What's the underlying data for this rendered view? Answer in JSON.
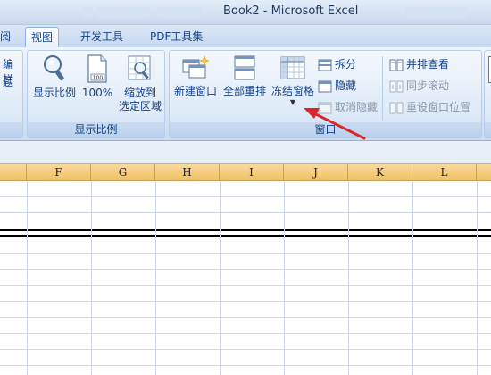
{
  "window": {
    "title": "Book2 - Microsoft Excel"
  },
  "tabs": [
    {
      "label": "阅"
    },
    {
      "label": "视图"
    },
    {
      "label": "开发工具"
    },
    {
      "label": "PDF工具集"
    }
  ],
  "ribbon": {
    "left_partial": [
      "编栏",
      "题"
    ],
    "zoom_group": {
      "label": "显示比例",
      "buttons": [
        {
          "label": "显示比例",
          "icon": "magnifier-icon"
        },
        {
          "label": "100%",
          "icon": "page-100-icon"
        },
        {
          "label_line1": "缩放到",
          "label_line2": "选定区域",
          "icon": "zoom-to-selection-icon"
        }
      ]
    },
    "window_group": {
      "label": "窗口",
      "big_buttons": [
        {
          "label": "新建窗口",
          "icon": "new-window-icon"
        },
        {
          "label": "全部重排",
          "icon": "arrange-all-icon"
        },
        {
          "label": "冻结窗格",
          "icon": "freeze-panes-icon"
        }
      ],
      "small_buttons_col1": [
        {
          "label": "拆分",
          "icon": "split-icon",
          "enabled": true
        },
        {
          "label": "隐藏",
          "icon": "hide-icon",
          "enabled": true
        },
        {
          "label": "取消隐藏",
          "icon": "unhide-icon",
          "enabled": false
        }
      ],
      "small_buttons_col2": [
        {
          "label": "并排查看",
          "icon": "side-by-side-icon",
          "enabled": true
        },
        {
          "label": "同步滚动",
          "icon": "sync-scroll-icon",
          "enabled": false
        },
        {
          "label": "重设窗口位置",
          "icon": "reset-window-icon",
          "enabled": false
        }
      ]
    }
  },
  "columns": [
    "F",
    "G",
    "H",
    "I",
    "J",
    "K",
    "L"
  ],
  "colors": {
    "accent_arrow": "#d9262a",
    "header_orange": "#f1c15f",
    "ribbon_text": "#15428b"
  }
}
